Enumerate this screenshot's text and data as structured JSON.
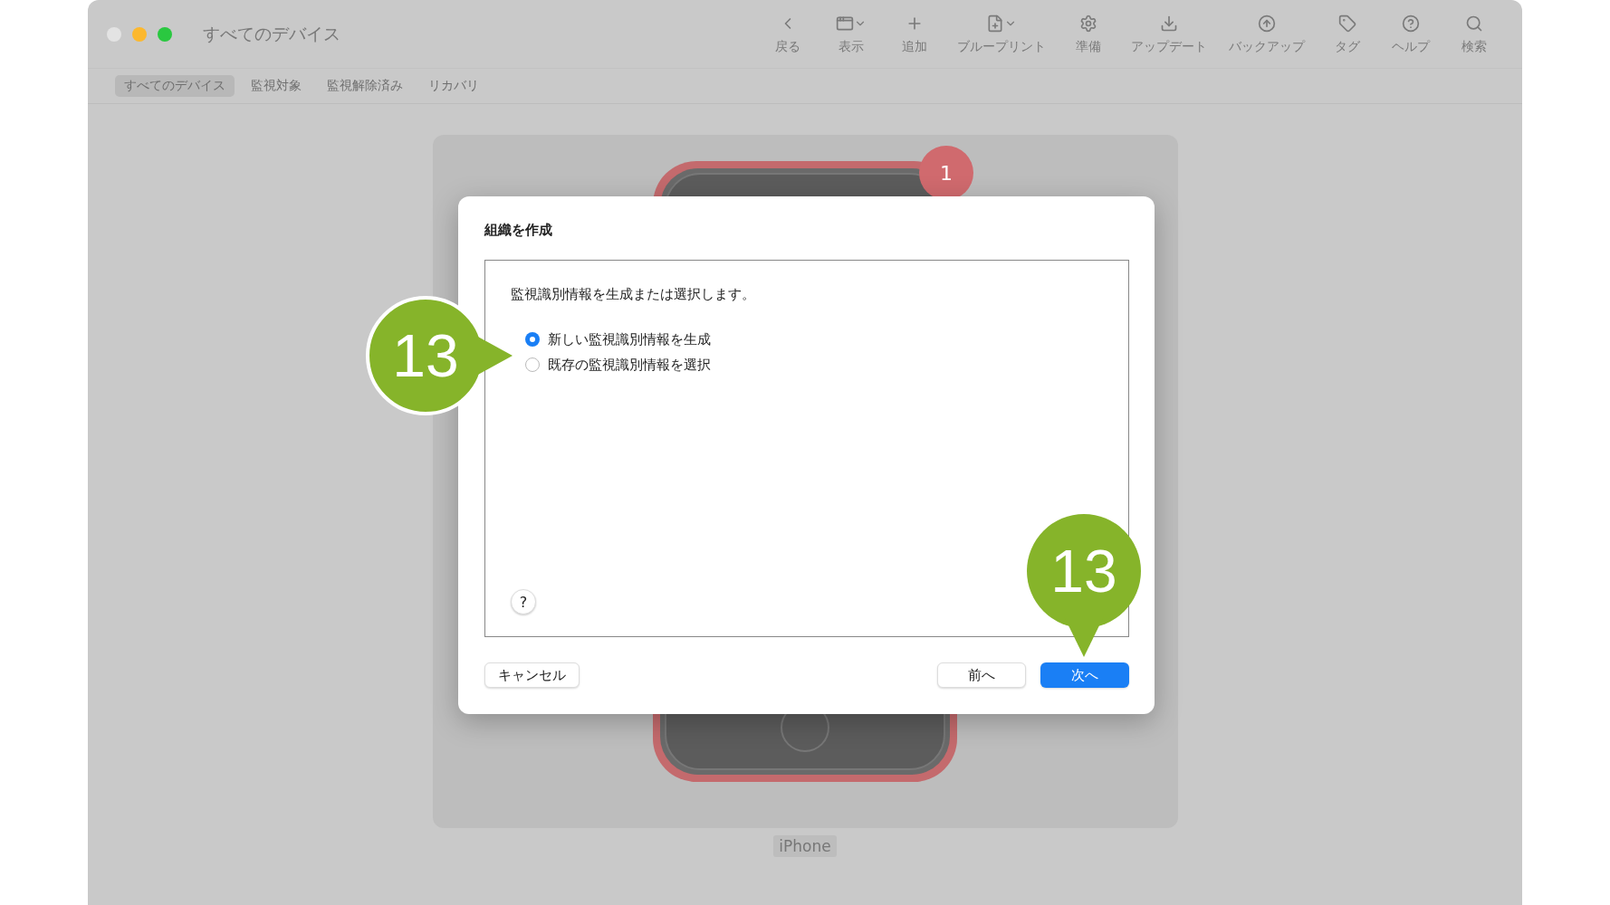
{
  "window": {
    "title": "すべてのデバイス"
  },
  "toolbar": [
    {
      "kind": "back",
      "label": "戻る"
    },
    {
      "kind": "view",
      "label": "表示"
    },
    {
      "kind": "add",
      "label": "追加"
    },
    {
      "kind": "blueprint",
      "label": "ブループリント"
    },
    {
      "kind": "prepare",
      "label": "準備"
    },
    {
      "kind": "update",
      "label": "アップデート"
    },
    {
      "kind": "backup",
      "label": "バックアップ"
    },
    {
      "kind": "tag",
      "label": "タグ"
    },
    {
      "kind": "help",
      "label": "ヘルプ"
    },
    {
      "kind": "search",
      "label": "検索"
    }
  ],
  "tabs": [
    {
      "label": "すべてのデバイス",
      "selected": true
    },
    {
      "label": "監視対象",
      "selected": false
    },
    {
      "label": "監視解除済み",
      "selected": false
    },
    {
      "label": "リカバリ",
      "selected": false
    }
  ],
  "device": {
    "label": "iPhone",
    "badge": "1"
  },
  "dialog": {
    "title": "組織を作成",
    "description": "監視識別情報を生成または選択します。",
    "options": [
      {
        "label": "新しい監視識別情報を生成",
        "selected": true
      },
      {
        "label": "既存の監視識別情報を選択",
        "selected": false
      }
    ],
    "help": "?",
    "buttons": [
      {
        "label": "キャンセル",
        "kind": "secondary"
      },
      {
        "label": "前へ",
        "kind": "secondary"
      },
      {
        "label": "次へ",
        "kind": "primary"
      }
    ]
  },
  "callouts": [
    {
      "label": "13",
      "kind": "right"
    },
    {
      "label": "13",
      "kind": "down"
    }
  ]
}
